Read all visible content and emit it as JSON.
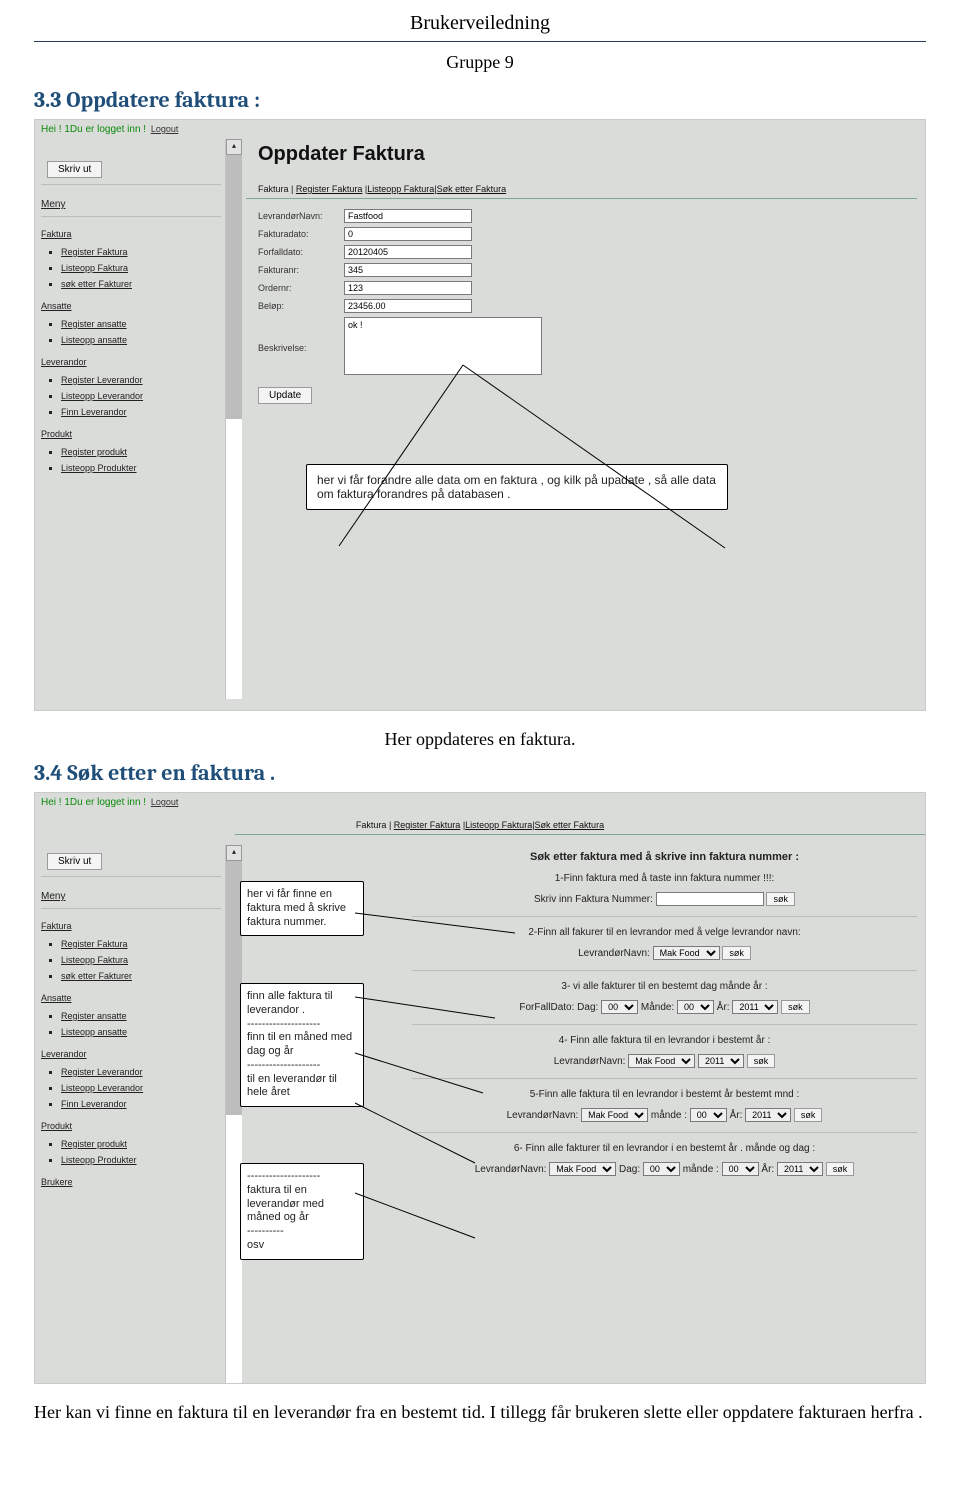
{
  "doc": {
    "title": "Brukerveiledning",
    "group": "Gruppe 9",
    "sec1": "3.3 Oppdatere faktura :",
    "caption1": "Her oppdateres en faktura.",
    "sec2": "3.4 Søk etter en faktura .",
    "bottom": "Her kan vi finne en faktura til en leverandør fra en bestemt tid.  I tillegg får brukeren slette eller oppdatere fakturaen herfra ."
  },
  "common": {
    "login": "Hei ! 1Du er logget inn !",
    "logout": "Logout",
    "print": "Skriv ut",
    "menu": "Meny",
    "update": "Update",
    "sok": "søk"
  },
  "sidebar": {
    "faktura": {
      "heading": "Faktura",
      "items": [
        "Register Faktura",
        "Listeopp Faktura",
        "søk etter Fakturer"
      ]
    },
    "ansatte": {
      "heading": "Ansatte",
      "items": [
        "Register ansatte",
        "Listeopp ansatte"
      ]
    },
    "leverandor": {
      "heading": "Leverandor",
      "items": [
        "Register Leverandor",
        "Listeopp Leverandor",
        "Finn Leverandor"
      ]
    },
    "produkt": {
      "heading": "Produkt",
      "items": [
        "Register produkt",
        "Listeopp Produkter"
      ]
    },
    "brukere": {
      "heading": "Brukere"
    }
  },
  "tabs": {
    "t1": "Faktura",
    "t2": "Register Faktura",
    "t3": "Listeopp Faktura",
    "t4": "Søk etter Faktura"
  },
  "shot1": {
    "title": "Oppdater Faktura",
    "fields": {
      "levnavn": {
        "label": "LevrandørNavn:",
        "value": "Fastfood"
      },
      "dato": {
        "label": "Fakturadato:",
        "value": "0"
      },
      "forfall": {
        "label": "Forfalldato:",
        "value": "20120405"
      },
      "nr": {
        "label": "Fakturanr:",
        "value": "345"
      },
      "ordernr": {
        "label": "Ordernr:",
        "value": "123"
      },
      "belop": {
        "label": "Beløp:",
        "value": "23456.00"
      },
      "beskriv": {
        "label": "Beskrivelse:",
        "value": "ok !"
      }
    },
    "callout": "her  vi får  forandre alle data om en faktura , og kilk på upadate , så alle data om faktura forandres på databasen ."
  },
  "shot2": {
    "header": "Søk etter faktura med å skrive inn faktura nummer :",
    "s1title": "1-Finn faktura med å taste inn faktura nummer !!!:",
    "s1label": "Skriv inn Faktura Nummer:",
    "s2title": "2-Finn all fakurer til en levrandor med å velge levrandor navn:",
    "s2label": "LevrandørNavn:",
    "s3title": "3- vi alle fakturer til en bestemt dag månde år :",
    "s3lead": "ForFallDato:",
    "dag": "Dag:",
    "mnd": "Månde:",
    "mnd2": "månde :",
    "ar": "År:",
    "s4title": "4- Finn alle faktura til en levrandor i bestemt år :",
    "s5title": "5-Finn alle faktura til en levrandor i bestemt år bestemt mnd :",
    "s6title": "6- Finn alle fakturer til en levrandor i en bestemt år . månde og dag :",
    "opt_levnavn": "Mak Food",
    "opt_dag": "00",
    "opt_mnd": "00",
    "opt_ar": "2011",
    "box1": "her  vi  får finne en faktura med å skrive faktura nummer.",
    "box2a": "finn alle faktura til leverandor .",
    "box2b": "finn til en måned med dag og år",
    "box2c": "til en leverandør til hele året",
    "box3a": "faktura til en leverandør med måned og år",
    "box3b": "osv",
    "dashes": "--------------------",
    "dashes2": "----------"
  }
}
